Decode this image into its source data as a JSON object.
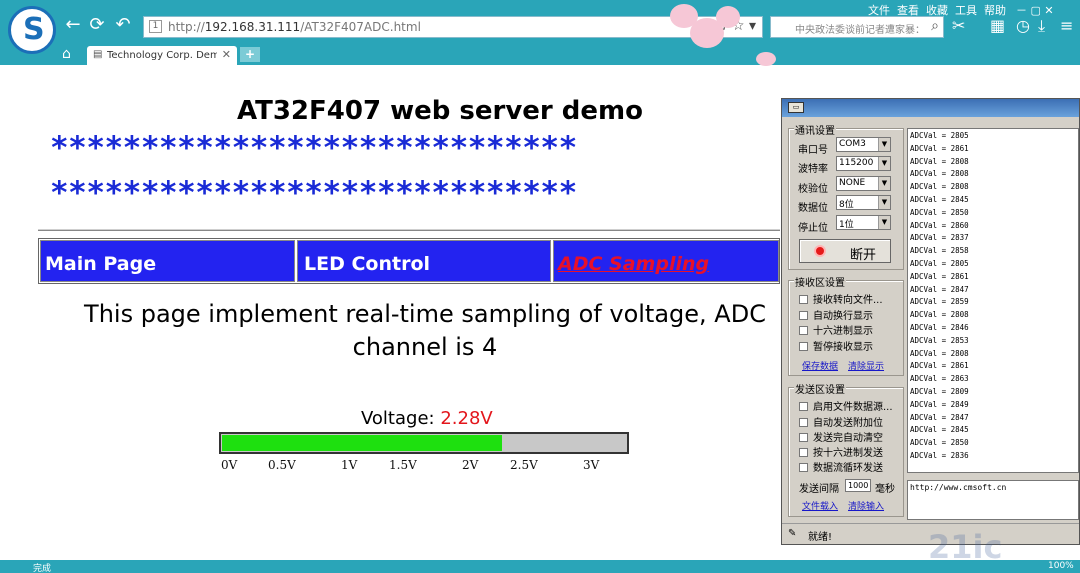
{
  "browser": {
    "address_protocol": "http://",
    "address_host": "192.168.31.111",
    "address_path": "/AT32F407ADC.html",
    "tab_title": "Technology Corp. Dem",
    "search_text": "中央政法委谈前记者遭家暴：",
    "menu": [
      "文件",
      "查看",
      "收藏",
      "工具",
      "帮助"
    ],
    "status_text": "完成",
    "zoom": "100%"
  },
  "page": {
    "title": "AT32F407 web server demo",
    "stars_row_1": "*****************************",
    "stars_row_2": "*****************************",
    "nav": [
      {
        "label": "Main Page"
      },
      {
        "label": "LED Control"
      },
      {
        "label": "ADC Sampling"
      }
    ],
    "description": "This page implement real-time sampling of voltage, ADC channel is 4",
    "voltage_label": "Voltage:",
    "voltage_value": "2.28V",
    "voltage_fraction": 0.693,
    "ticks": [
      "0V",
      "0.5V",
      "1V",
      "1.5V",
      "2V",
      "2.5V",
      "3V"
    ]
  },
  "serial": {
    "comm_group_title": "通讯设置",
    "port_label": "串口号",
    "port_value": "COM3",
    "baud_label": "波特率",
    "baud_value": "115200",
    "parity_label": "校验位",
    "parity_value": "NONE",
    "databits_label": "数据位",
    "databits_value": "8位",
    "stopbits_label": "停止位",
    "stopbits_value": "1位",
    "open_button": "断开",
    "rx_group_title": "接收区设置",
    "rx_options": [
      "接收转向文件...",
      "自动换行显示",
      "十六进制显示",
      "暂停接收显示"
    ],
    "rx_save": "保存数据",
    "rx_clear": "清除显示",
    "tx_group_title": "发送区设置",
    "tx_options": [
      "启用文件数据源...",
      "自动发送附加位",
      "发送完自动清空",
      "按十六进制发送",
      "数据流循环发送"
    ],
    "interval_label": "发送间隔",
    "interval_value": "1000",
    "interval_unit": "毫秒",
    "load_file": "文件载入",
    "clear_input": "清除输入",
    "rx_lines": [
      "ADCVal = 2805",
      "ADCVal = 2861",
      "ADCVal = 2808",
      "ADCVal = 2808",
      "ADCVal = 2808",
      "ADCVal = 2845",
      "ADCVal = 2850",
      "ADCVal = 2860",
      "ADCVal = 2837",
      "ADCVal = 2858",
      "ADCVal = 2805",
      "ADCVal = 2861",
      "ADCVal = 2847",
      "ADCVal = 2859",
      "ADCVal = 2808",
      "ADCVal = 2846",
      "ADCVal = 2853",
      "ADCVal = 2808",
      "ADCVal = 2861",
      "ADCVal = 2863",
      "ADCVal = 2809",
      "ADCVal = 2849",
      "ADCVal = 2847",
      "ADCVal = 2845",
      "ADCVal = 2850",
      "ADCVal = 2836"
    ],
    "tx_text": "http://www.cmsoft.cn",
    "status_ready": "就绪!"
  }
}
